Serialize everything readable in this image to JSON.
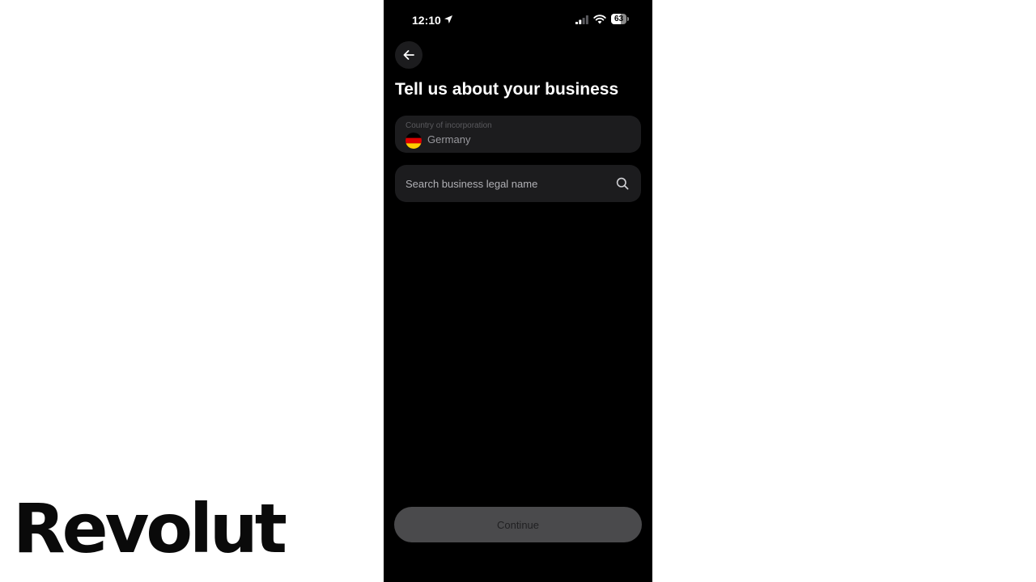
{
  "brand": {
    "logo_text": "Revolut"
  },
  "status_bar": {
    "time": "12:10",
    "battery_level": "63",
    "icons": [
      "location-arrow-icon",
      "cellular-signal-icon",
      "wifi-icon",
      "battery-icon"
    ]
  },
  "header": {
    "back_icon": "arrow-left-icon",
    "title": "Tell us about your business"
  },
  "form": {
    "country": {
      "label": "Country of incorporation",
      "value": "Germany",
      "flag_icon": "germany-flag-icon"
    },
    "search": {
      "placeholder": "Search business legal name",
      "value": "",
      "icon": "search-icon"
    }
  },
  "footer": {
    "continue_label": "Continue",
    "continue_state": "disabled"
  },
  "colors": {
    "app_background": "#000000",
    "field_background": "#1c1c1e",
    "button_disabled": "#4a4a4c",
    "flag_black": "#000000",
    "flag_red": "#dd0000",
    "flag_gold": "#ffce00"
  }
}
